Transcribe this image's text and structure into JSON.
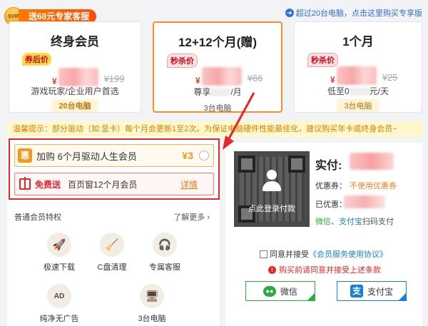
{
  "header": {
    "svip_text": "SVIP",
    "badge_label": "送68元专家客服",
    "top_link": "超过20台电脑，点击这里购买专享版"
  },
  "plans": [
    {
      "title": "终身会员",
      "tag": "券后价",
      "yen": "¥",
      "orig_price": "¥199",
      "subtitle": "游戏玩家/企业用户首选",
      "pc_count": "20台电脑"
    },
    {
      "title": "12+12个月(赠)",
      "tag": "秒杀价",
      "yen": "¥",
      "orig_price": "¥66",
      "subtitle_prefix": "尊享",
      "subtitle_suffix": "/月",
      "pc_count": "3台电脑"
    },
    {
      "title": "1个月",
      "tag": "秒杀价",
      "yen": "¥",
      "orig_price": "¥25",
      "subtitle_prefix": "低至0",
      "subtitle_suffix": "元/天",
      "pc_count": "3台电脑"
    }
  ],
  "warning": "温馨提示：部分驱动（如:显卡）每个月会更新1至2次。为保证电脑硬件性能最佳化，建议购买年卡或终身会员~",
  "addons": {
    "addon1_icon": "惠",
    "addon1_text": "加购 6个月驱动人生会员",
    "addon1_price": "¥3",
    "addon2_free": "免费送",
    "addon2_text": "百页窗12个月会员",
    "addon2_detail": "详情"
  },
  "privileges": {
    "header": "普通会员特权",
    "learn_more": "了解更多 ›",
    "items": [
      {
        "label": "极速下载",
        "icon": "rocket-icon",
        "glyph": "🚀"
      },
      {
        "label": "C盘清理",
        "icon": "broom-icon",
        "glyph": "🧹"
      },
      {
        "label": "专属客服",
        "icon": "headset-icon",
        "glyph": "🎧"
      },
      {
        "label": "纯净无广告",
        "icon": "no-ad-icon",
        "glyph": "AD"
      },
      {
        "label": "3台电脑",
        "icon": "monitor-icon",
        "glyph": "🖥"
      }
    ]
  },
  "payment": {
    "qr_text": "点此登录付款",
    "pay_label": "实付:",
    "coupon_label": "优惠券：",
    "coupon_value": "不使用优惠券",
    "discount_label": "已优惠：",
    "scan_wechat": "微信",
    "scan_sep": "、",
    "scan_alipay": "支付宝",
    "scan_rest": "扫码支付",
    "agree_prefix": "同意并接受",
    "agree_link": "《会员服务使用协议》",
    "warn_text": "购买前请同意并接受上述条款",
    "wechat_label": "微信",
    "alipay_label": "支付宝",
    "alipay_glyph": "支"
  },
  "colors": {
    "accent_orange": "#ff8a2a",
    "price_red": "#e63b2e",
    "highlight_red": "#e8262a",
    "wechat_green": "#2eaa41",
    "alipay_blue": "#1a7fdc"
  }
}
